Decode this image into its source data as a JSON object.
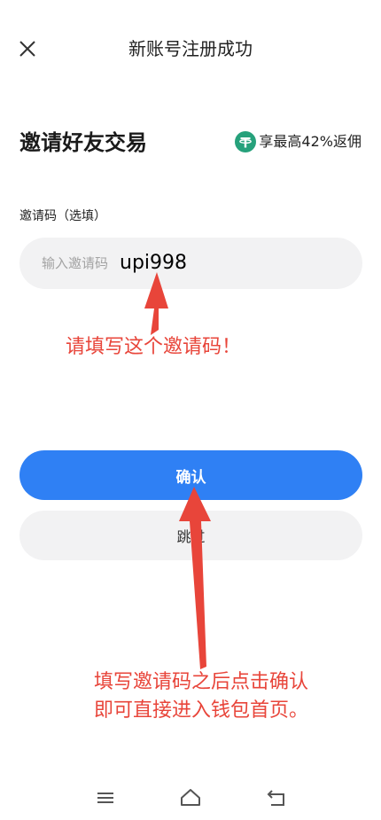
{
  "header": {
    "title": "新账号注册成功",
    "close_icon": "close-icon"
  },
  "section": {
    "title": "邀请好友交易",
    "rebate_text": "享最高42%返佣",
    "rebate_icon": "tether-icon",
    "rebate_icon_letter": "₮",
    "rebate_icon_color": "#26a17b"
  },
  "form": {
    "label": "邀请码（选填）",
    "placeholder": "输入邀请码",
    "handwritten_code": "upi998"
  },
  "buttons": {
    "confirm_label": "确认",
    "skip_label": "跳过",
    "confirm_color": "#2f80f4"
  },
  "annotations": {
    "note1": "请填写这个邀请码！",
    "note2_line1": "填写邀请码之后点击确认",
    "note2_line2": "即可直接进入钱包首页。",
    "color": "#e8453a"
  },
  "bottom_nav": {
    "menu_icon": "menu-icon",
    "home_icon": "home-icon",
    "back_icon": "back-icon"
  }
}
